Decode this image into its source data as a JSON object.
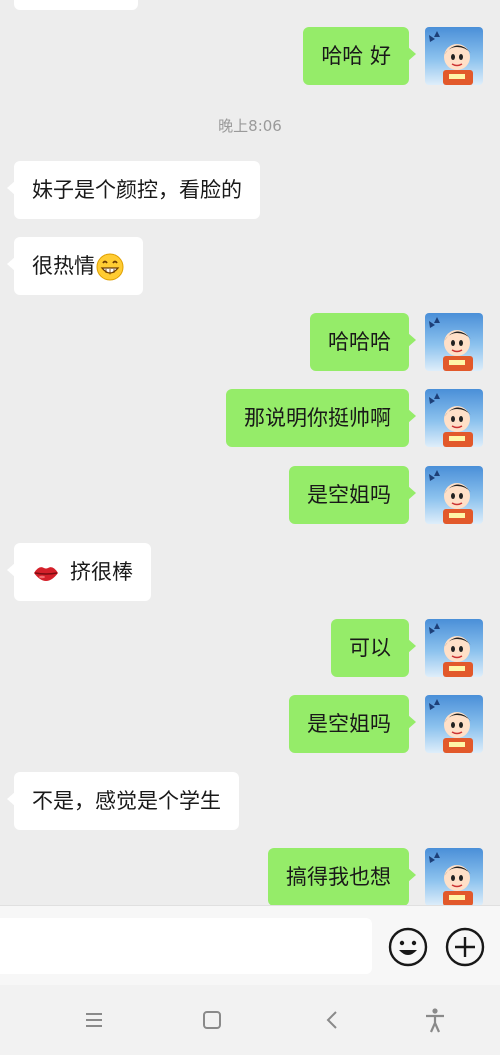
{
  "chat": {
    "timestamp": "晚上8:06",
    "messages": [
      {
        "side": "out",
        "text": "哈哈 好"
      },
      {
        "side": "in",
        "text": "妹子是个颜控，看脸的"
      },
      {
        "side": "in",
        "text": "很热情",
        "emoji": "grin-emoji"
      },
      {
        "side": "out",
        "text": "哈哈哈"
      },
      {
        "side": "out",
        "text": "那说明你挺帅啊"
      },
      {
        "side": "out",
        "text": "是空姐吗"
      },
      {
        "side": "in",
        "text": "挤很棒",
        "emoji_before": "lips-emoji"
      },
      {
        "side": "out",
        "text": "可以"
      },
      {
        "side": "out",
        "text": "是空姐吗"
      },
      {
        "side": "in",
        "text": "不是，感觉是个学生"
      },
      {
        "side": "out",
        "text": "搞得我也想"
      }
    ]
  },
  "input_bar": {
    "icons": [
      "emoji-icon",
      "plus-icon"
    ]
  },
  "nav_bar": {
    "icons": [
      "menu-icon",
      "home-icon",
      "back-icon",
      "accessibility-icon"
    ]
  },
  "colors": {
    "background": "#ededed",
    "outgoing_bubble": "#95ec69",
    "incoming_bubble": "#ffffff",
    "timestamp": "#9a9a9a"
  }
}
